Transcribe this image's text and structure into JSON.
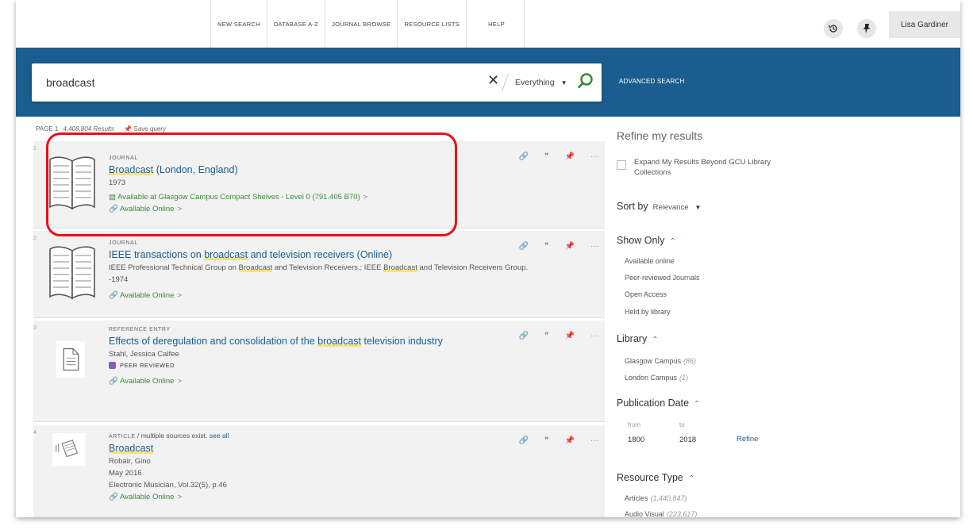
{
  "nav": {
    "links": [
      "NEW SEARCH",
      "DATABASE A-Z",
      "JOURNAL BROWSE",
      "RESOURCE LISTS",
      "HELP"
    ],
    "user_name": "Lisa Gardiner",
    "history_icon": "history-icon",
    "pin_icon": "pin-icon"
  },
  "search": {
    "query": "broadcast",
    "scope": "Everything",
    "advanced_label": "ADVANCED SEARCH"
  },
  "results_meta": {
    "page_text": "PAGE 1",
    "results_text": "4,408,804 Results",
    "save_query": "Save query"
  },
  "results": [
    {
      "num": "1",
      "type": "JOURNAL",
      "title_pre": "",
      "title_hl": "Broadcast",
      "title_post": " (London, England)",
      "line1": "1973",
      "location": "Available at Glasgow Campus  Compact Shelves - Level 0 (791.405 B70)",
      "online": "Available Online"
    },
    {
      "num": "2",
      "type": "JOURNAL",
      "title_pre": "IEEE transactions on ",
      "title_hl": "broadcast",
      "title_post": " and television receivers (Online)",
      "line1_pre": "IEEE Professional Technical Group on ",
      "line1_hl1": "Broadcast",
      "line1_mid": " and Television Receivers.; IEEE ",
      "line1_hl2": "Broadcast",
      "line1_post": " and Television Receivers Group.",
      "line2": "-1974",
      "online": "Available Online"
    },
    {
      "num": "3",
      "type": "REFERENCE ENTRY",
      "title_pre": "Effects of deregulation and consolidation of the ",
      "title_hl": "broadcast",
      "title_post": " television industry",
      "line1": "Stahl, Jessica Calfee",
      "peer": "PEER REVIEWED",
      "online": "Available Online"
    },
    {
      "num": "4",
      "type": "ARTICLE",
      "multi": " / multiple sources exist.",
      "see_all": "see all",
      "title_pre": "",
      "title_hl": "Broadcast",
      "title_post": "",
      "line1": "Robair, Gino",
      "line2": "May 2016",
      "line3": "Electronic Musician, Vol.32(5), p.46",
      "online": "Available Online"
    }
  ],
  "sidebar": {
    "title": "Refine my results",
    "expand_label": "Expand My Results Beyond GCU Library Collections",
    "sort_label": "Sort by",
    "sort_value": "Relevance",
    "show_only": {
      "heading": "Show Only",
      "items": [
        "Available online",
        "Peer-reviewed Journals",
        "Open Access",
        "Held by library"
      ]
    },
    "library": {
      "heading": "Library",
      "items": [
        {
          "label": "Glasgow Campus",
          "count": "(86)"
        },
        {
          "label": "London Campus",
          "count": "(1)"
        }
      ]
    },
    "pub_date": {
      "heading": "Publication Date",
      "from_label": "from",
      "to_label": "to",
      "from_value": "1800",
      "to_value": "2018",
      "refine": "Refine"
    },
    "resource_type": {
      "heading": "Resource Type",
      "items": [
        {
          "label": "Articles",
          "count": "(1,440,847)"
        },
        {
          "label": "Audio Visual",
          "count": "(223,617)"
        }
      ]
    }
  },
  "colors": {
    "band": "#1a5d8f",
    "link": "#1a5d8f",
    "available": "#3a8a3a",
    "annotation": "#e8101a"
  }
}
